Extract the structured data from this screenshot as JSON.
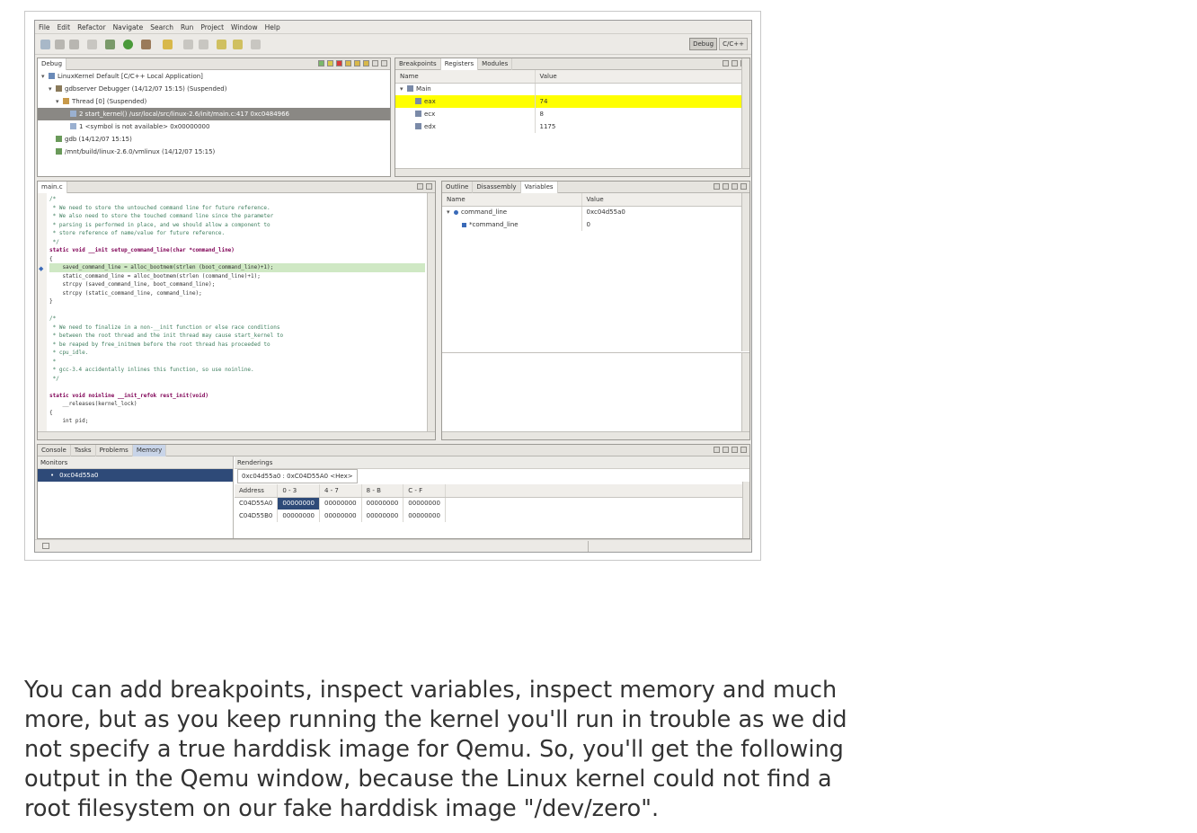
{
  "menu": [
    "File",
    "Edit",
    "Refactor",
    "Navigate",
    "Search",
    "Run",
    "Project",
    "Window",
    "Help"
  ],
  "perspectives": [
    "Debug",
    "C/C++"
  ],
  "debug_view": {
    "tab": "Debug",
    "rows": [
      {
        "text": "LinuxKernel Default [C/C++ Local Application]",
        "indent": 0
      },
      {
        "text": "gdbserver Debugger (14/12/07 15:15) (Suspended)",
        "indent": 1
      },
      {
        "text": "Thread [0] (Suspended)",
        "indent": 2
      },
      {
        "text": "2 start_kernel() /usr/local/src/linux-2.6/init/main.c:417 0xc0484966",
        "indent": 3,
        "selected": true
      },
      {
        "text": "1 <symbol is not available> 0x00000000",
        "indent": 3
      },
      {
        "text": "gdb (14/12/07 15:15)",
        "indent": 1
      },
      {
        "text": "/mnt/build/linux-2.6.0/vmlinux (14/12/07 15:15)",
        "indent": 1
      }
    ]
  },
  "registers_view": {
    "tabs": [
      "Breakpoints",
      "Registers",
      "Modules"
    ],
    "columns": [
      "Name",
      "Value"
    ],
    "group": "Main",
    "rows": [
      {
        "name": "eax",
        "value": "74",
        "highlight": true
      },
      {
        "name": "ecx",
        "value": "8"
      },
      {
        "name": "edx",
        "value": "1175"
      }
    ]
  },
  "editor": {
    "tab": "main.c",
    "lines": [
      {
        "t": "/*",
        "c": "cm"
      },
      {
        "t": " * We need to store the untouched command line for future reference.",
        "c": "cm"
      },
      {
        "t": " * We also need to store the touched command line since the parameter",
        "c": "cm"
      },
      {
        "t": " * parsing is performed in place, and we should allow a component to",
        "c": "cm"
      },
      {
        "t": " * store reference of name/value for future reference.",
        "c": "cm"
      },
      {
        "t": " */",
        "c": "cm"
      },
      {
        "t": "static void __init setup_command_line(char *command_line)",
        "c": "kw"
      },
      {
        "t": "{",
        "c": "pl"
      },
      {
        "t": "    saved_command_line = alloc_bootmem(strlen (boot_command_line)+1);",
        "c": "hl"
      },
      {
        "t": "    static_command_line = alloc_bootmem(strlen (command_line)+1);",
        "c": "pl"
      },
      {
        "t": "    strcpy (saved_command_line, boot_command_line);",
        "c": "pl"
      },
      {
        "t": "    strcpy (static_command_line, command_line);",
        "c": "pl"
      },
      {
        "t": "}",
        "c": "pl"
      },
      {
        "t": "",
        "c": "pl"
      },
      {
        "t": "/*",
        "c": "cm"
      },
      {
        "t": " * We need to finalize in a non-__init function or else race conditions",
        "c": "cm"
      },
      {
        "t": " * between the root thread and the init thread may cause start_kernel to",
        "c": "cm"
      },
      {
        "t": " * be reaped by free_initmem before the root thread has proceeded to",
        "c": "cm"
      },
      {
        "t": " * cpu_idle.",
        "c": "cm"
      },
      {
        "t": " *",
        "c": "cm"
      },
      {
        "t": " * gcc-3.4 accidentally inlines this function, so use noinline.",
        "c": "cm"
      },
      {
        "t": " */",
        "c": "cm"
      },
      {
        "t": "",
        "c": "pl"
      },
      {
        "t": "static void noinline __init_refok rest_init(void)",
        "c": "kw"
      },
      {
        "t": "    __releases(kernel_lock)",
        "c": "pl"
      },
      {
        "t": "{",
        "c": "pl"
      },
      {
        "t": "    int pid;",
        "c": "pl"
      }
    ]
  },
  "variables_view": {
    "tabs": [
      "Outline",
      "Disassembly",
      "Variables"
    ],
    "columns": [
      "Name",
      "Value"
    ],
    "rows": [
      {
        "name": "command_line",
        "value": "0xc04d55a0",
        "indent": 0
      },
      {
        "name": "*command_line",
        "value": "0",
        "indent": 1
      }
    ]
  },
  "memory_view": {
    "tabs": [
      "Console",
      "Tasks",
      "Problems",
      "Memory"
    ],
    "monitors_label": "Monitors",
    "monitor_item": "0xc04d55a0",
    "renderings_label": "Renderings",
    "rendering_tab": "0xc04d55a0 : 0xC04D55A0 <Hex>",
    "columns": [
      "Address",
      "0 - 3",
      "4 - 7",
      "8 - B",
      "C - F"
    ],
    "rows": [
      [
        "C04D55A0",
        "00000000",
        "00000000",
        "00000000",
        "00000000"
      ],
      [
        "C04D55B0",
        "00000000",
        "00000000",
        "00000000",
        "00000000"
      ]
    ]
  },
  "paragraph": "You can add breakpoints, inspect variables, inspect memory and much more, but as you keep running the kernel you'll run in trouble as we did not specify a true harddisk image for Qemu. So, you'll get the following output in the Qemu window, because the Linux kernel could not find a root filesystem on our fake harddisk image \"/dev/zero\".",
  "colors": {
    "highlight": "#ffff00",
    "selection": "#8a8884",
    "keyword": "#7f0055",
    "comment": "#3f7f5f"
  }
}
